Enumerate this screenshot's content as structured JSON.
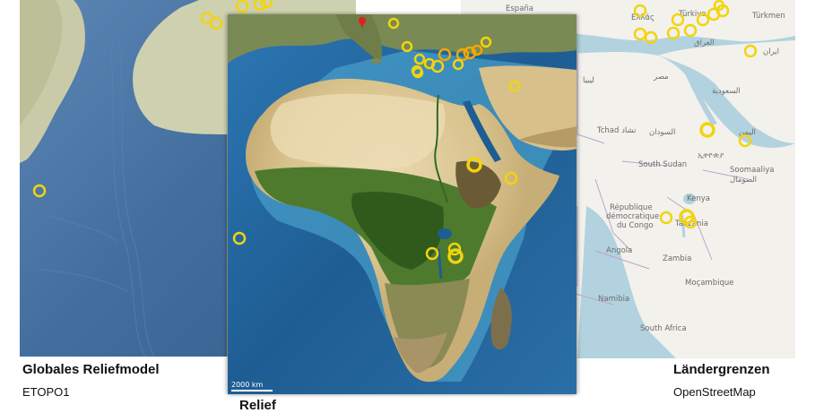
{
  "captions": {
    "left_title": "Globales Reliefmodel",
    "left_sub": "ETOPO1",
    "right_title": "Ländergrenzen",
    "right_sub": "OpenStreetMap",
    "center_title": "Relief"
  },
  "scale_bar": {
    "label": "2000 km"
  },
  "osm_labels": {
    "espana": "España",
    "ellas": "Ελλάς",
    "turkiye": "Türkiye",
    "turkmen": "Türkmen",
    "iraq": "العراق",
    "iran": "ایران",
    "libya": "ليبيا",
    "egypt": "مصر",
    "saudi": "السعودية",
    "tchad": "Tchad تشاد",
    "sudan": "السودان",
    "yemen": "اليمن",
    "south_sudan": "South Sudan",
    "ethiopia": "ኢትዮጵያ",
    "somalia": "Soomaaliya",
    "somalia_ar": "الصومال",
    "kenya": "Kenya",
    "drc_1": "République",
    "drc_2": "démocratique",
    "drc_3": "du Congo",
    "tanzania": "Tanzania",
    "angola": "Angola",
    "zambia": "Zambia",
    "mocambique": "Moçambique",
    "namibia": "Namibia",
    "south_africa": "South Africa"
  },
  "colors": {
    "marker": "#f2d40e",
    "marker_orange": "#f0a800",
    "red_marker": "#e02020",
    "ocean_relief": "#1e5d93",
    "osm_water": "#b3d2df",
    "osm_land": "#f3f1ec"
  }
}
